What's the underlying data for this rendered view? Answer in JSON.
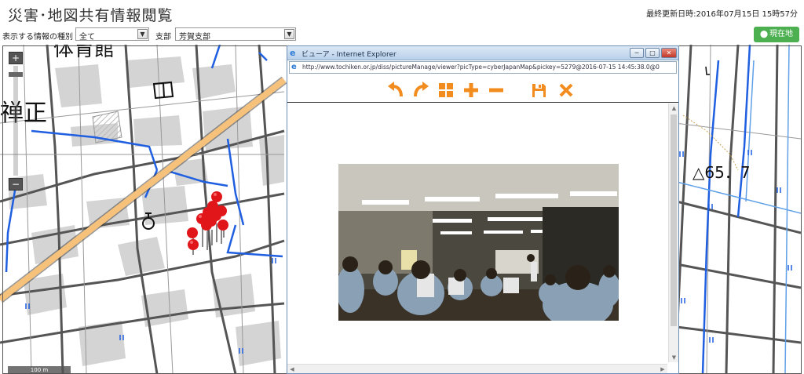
{
  "header": {
    "title": "災害･地図共有情報閲覧",
    "last_updated": "最終更新日時:2016年07月15日 15時57分"
  },
  "filters": {
    "info_type_label": "表示する情報の種別",
    "info_type_value": "全て",
    "branch_label": "支部",
    "branch_value": "芳賀支部"
  },
  "location_button": {
    "label": "現在地",
    "icon": "map-pin-icon"
  },
  "map": {
    "labels": {
      "gymnasium": "体育館",
      "zen": "禅正",
      "elevation": "△65．7"
    },
    "zoom_in": "+",
    "zoom_out": "−",
    "scale": "100 m",
    "marker_color": "#e0161b",
    "road_main_color": "#f6c27b",
    "road_water_color": "#1f5fe0"
  },
  "viewer": {
    "window_title": "ビューア - Internet Explorer",
    "url": "http://www.tochiken.or.jp/diss/pictureManage/viewer?picType=cyberJapanMap&pickey=5279@2016-07-15 14:45:38.0@0",
    "toolbar": [
      {
        "name": "rotate-left-icon",
        "title": "左回転"
      },
      {
        "name": "rotate-right-icon",
        "title": "右回転"
      },
      {
        "name": "grid-icon",
        "title": "一覧"
      },
      {
        "name": "zoom-in-icon",
        "title": "拡大"
      },
      {
        "name": "zoom-out-icon",
        "title": "縮小"
      },
      {
        "name": "save-icon",
        "title": "保存"
      },
      {
        "name": "close-icon",
        "title": "閉じる"
      }
    ],
    "tool_color": "#f28c1e",
    "buttons": {
      "minimize": "─",
      "maximize": "□",
      "close": "✕"
    }
  }
}
